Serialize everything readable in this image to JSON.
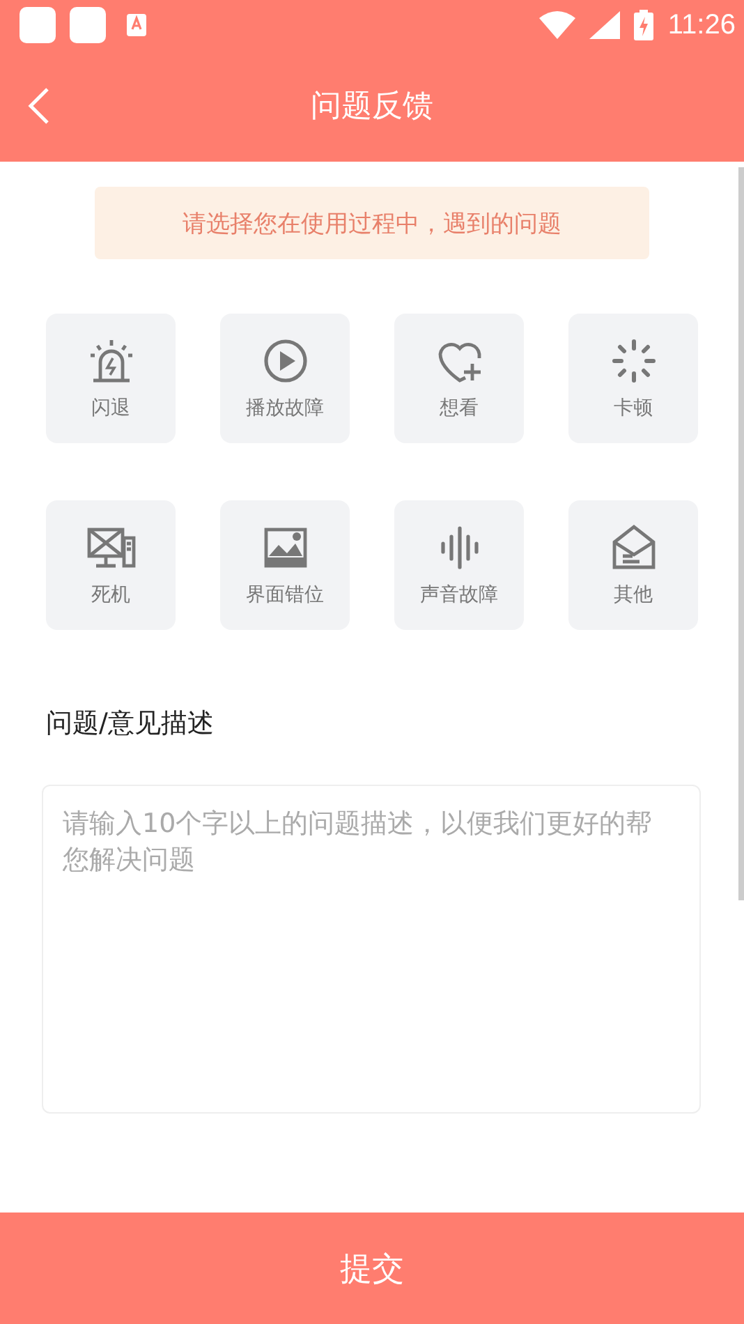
{
  "status_bar": {
    "time": "11:26"
  },
  "header": {
    "title": "问题反馈"
  },
  "notice": "请选择您在使用过程中，遇到的问题",
  "categories": [
    {
      "label": "闪退",
      "kind": "alarm"
    },
    {
      "label": "播放故障",
      "kind": "play"
    },
    {
      "label": "想看",
      "kind": "heart"
    },
    {
      "label": "卡顿",
      "kind": "spinner"
    },
    {
      "label": "死机",
      "kind": "computer"
    },
    {
      "label": "界面错位",
      "kind": "image"
    },
    {
      "label": "声音故障",
      "kind": "sound"
    },
    {
      "label": "其他",
      "kind": "envelope"
    }
  ],
  "description": {
    "heading": "问题/意见描述",
    "placeholder": "请输入10个字以上的问题描述，以便我们更好的帮您解决问题"
  },
  "submit_button": "提交"
}
